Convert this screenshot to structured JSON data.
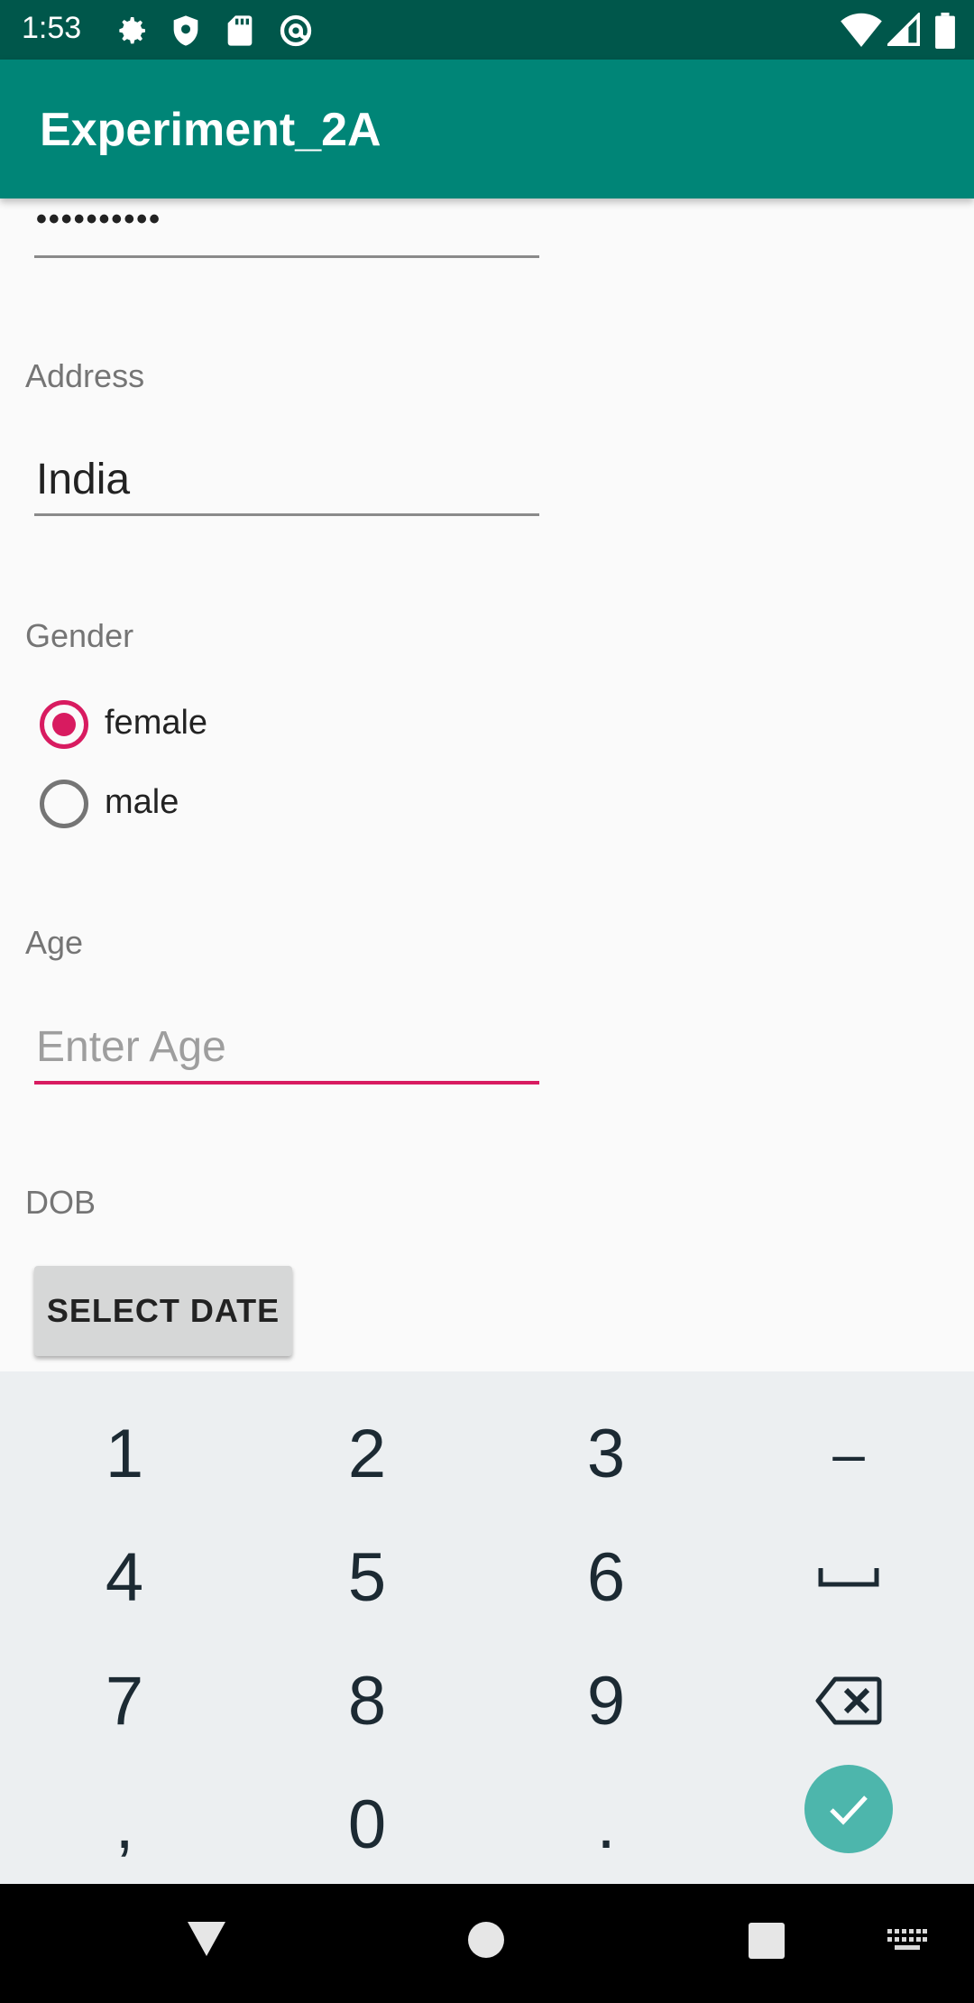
{
  "status_bar": {
    "time": "1:53",
    "icons": [
      "gear-icon",
      "shield-icon",
      "sd-card-icon",
      "at-sign-icon",
      "wifi-icon",
      "cell-signal-icon",
      "battery-icon"
    ]
  },
  "app_bar": {
    "title": "Experiment_2A"
  },
  "form": {
    "password": {
      "value": "••••••••••"
    },
    "address": {
      "label": "Address",
      "value": "India"
    },
    "gender": {
      "label": "Gender",
      "options": [
        {
          "label": "female",
          "checked": true
        },
        {
          "label": "male",
          "checked": false
        }
      ]
    },
    "age": {
      "label": "Age",
      "placeholder": "Enter Age",
      "value": ""
    },
    "dob": {
      "label": "DOB",
      "button": "SELECT DATE"
    }
  },
  "keyboard": {
    "rows": [
      [
        "1",
        "2",
        "3",
        "–"
      ],
      [
        "4",
        "5",
        "6",
        "␣"
      ],
      [
        "7",
        "8",
        "9",
        "⌫"
      ],
      [
        ",",
        "0",
        ".",
        "✓"
      ]
    ]
  },
  "nav_bar": {
    "icons": [
      "back-icon",
      "home-icon",
      "recents-icon",
      "keyboard-icon"
    ]
  },
  "colors": {
    "primary": "#008577",
    "primary_dark": "#00574b",
    "accent": "#d81b60",
    "done_key": "#4db6ac"
  }
}
